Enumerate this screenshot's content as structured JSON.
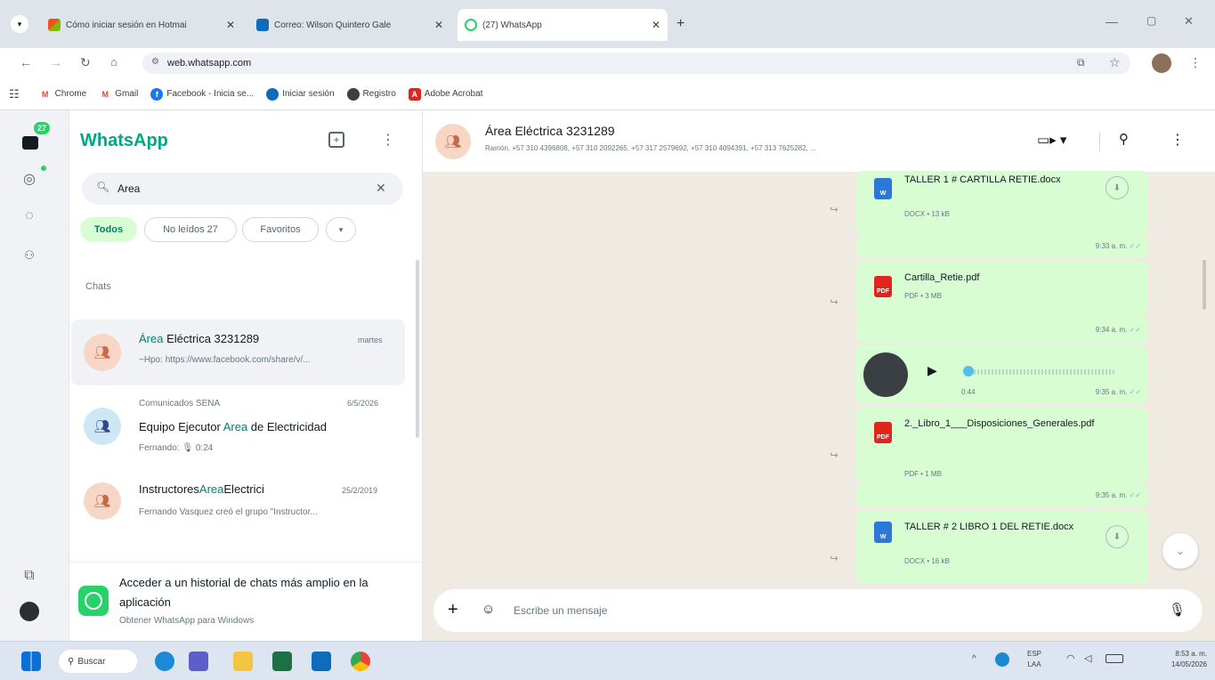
{
  "browser": {
    "tabs": [
      {
        "title": "Cómo iniciar sesión en Hotmai"
      },
      {
        "title": "Correo: Wilson Quintero Gale"
      },
      {
        "title": "(27) WhatsApp"
      }
    ],
    "url": "web.whatsapp.com",
    "bookmarks": [
      "Chrome",
      "Gmail",
      "Facebook - Inicia se...",
      "Iniciar sesión",
      "Registro",
      "Adobe Acrobat"
    ]
  },
  "rail": {
    "chats_badge": "27"
  },
  "sidebar": {
    "app_title": "WhatsApp",
    "search_value": "Area",
    "filters": [
      "Todos",
      "No leídos 27",
      "Favoritos"
    ],
    "section_label": "Chats",
    "chats": [
      {
        "name_prefix": "Área",
        "name_rest": " Eléctrica 3231289",
        "time": "martes",
        "preview": "~Hpo: https://www.facebook.com/share/v/..."
      },
      {
        "group": "Comunicados SENA",
        "name_a": "Equipo Ejecutor ",
        "name_hl": "Area",
        "name_b": " de Electricidad",
        "time": "6/5/2026",
        "preview_sender": "Fernando:",
        "preview_audio": "0:24"
      },
      {
        "name_a": "Instructores",
        "name_hl": "Area",
        "name_b": "Electrici",
        "time": "25/2/2019",
        "preview": "Fernando Vasquez creó el grupo \"Instructor..."
      }
    ],
    "promo": {
      "title": "Acceder a un historial de chats más amplio en la aplicación",
      "link": "Obtener WhatsApp para Windows"
    }
  },
  "chat": {
    "name": "Área Eléctrica 3231289",
    "members": "Ramón, +57 310 4396808, +57 310 2092265, +57 317 2579692, +57 310 4094391, +57 313 7625282, ...",
    "messages": [
      {
        "file": "TALLER 1 # CARTILLA RETIE.docx",
        "meta": "DOCX • 13 kB",
        "time": "9:33 a. m."
      },
      {
        "file": "Cartilla_Retie.pdf",
        "meta": "PDF • 3 MB",
        "time": "9:34 a. m."
      },
      {
        "audio_duration": "0:44",
        "time": "9:35 a. m."
      },
      {
        "file": "2._Libro_1___Disposiciones_Generales.pdf",
        "meta": "PDF • 1 MB",
        "time": "9:35 a. m."
      },
      {
        "file": "TALLER # 2 LIBRO 1 DEL RETIE.docx",
        "meta": "DOCX • 16 kB"
      }
    ],
    "composer_placeholder": "Escribe un mensaje"
  },
  "taskbar": {
    "search": "Buscar",
    "lang1": "ESP",
    "lang2": "LAA",
    "time": "8:53 a. m.",
    "date": "14/05/2026"
  },
  "colors": {
    "accent": "#00a884",
    "bubble": "#d9fdd3",
    "chat_bg": "#efeae2"
  }
}
